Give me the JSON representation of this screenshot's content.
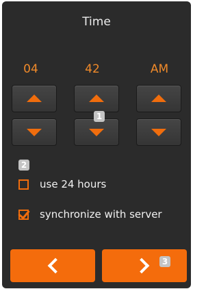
{
  "header": {
    "title": "Time"
  },
  "time_picker": {
    "hours": "04",
    "minutes": "42",
    "period": "AM",
    "up_icon": "arrow-up-icon",
    "down_icon": "arrow-down-icon"
  },
  "markers": {
    "m1": "1",
    "m2": "2",
    "m3": "3"
  },
  "options": {
    "use_24_hours": {
      "label": "use 24 hours",
      "checked": false
    },
    "synchronize": {
      "label": "synchronize with server",
      "checked": true
    }
  },
  "navigation": {
    "back_icon": "chevron-left-icon",
    "next_icon": "chevron-right-icon"
  },
  "colors": {
    "accent": "#f06d0d",
    "background": "#2b2b2b",
    "value_text": "#f08a2a",
    "text": "#f2f2f2"
  }
}
